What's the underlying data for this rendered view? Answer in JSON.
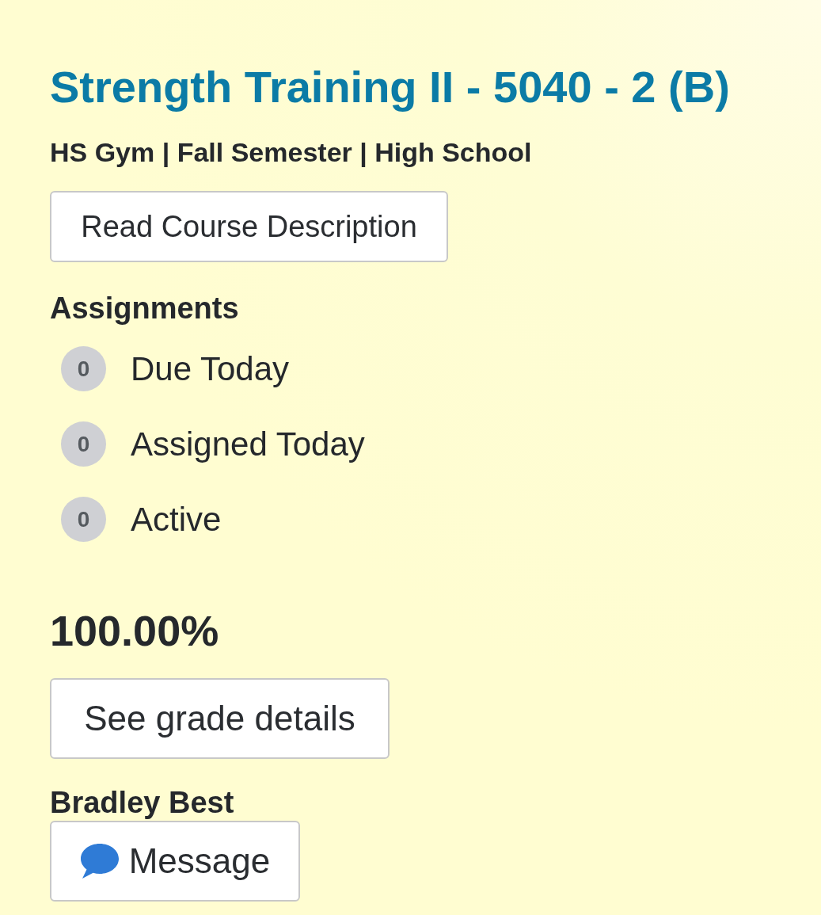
{
  "course": {
    "title": "Strength Training II - 5040 - 2 (B)",
    "details": "HS Gym | Fall Semester | High School",
    "description_button": "Read Course Description"
  },
  "assignments": {
    "heading": "Assignments",
    "items": [
      {
        "count": "0",
        "label": "Due Today"
      },
      {
        "count": "0",
        "label": "Assigned Today"
      },
      {
        "count": "0",
        "label": "Active"
      }
    ]
  },
  "grade": {
    "percent": "100.00%",
    "details_button": "See grade details"
  },
  "teacher": {
    "name": "Bradley Best",
    "message_button": "Message"
  }
}
